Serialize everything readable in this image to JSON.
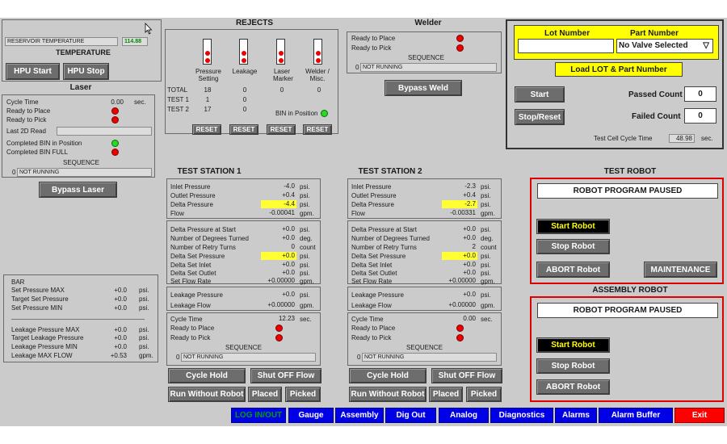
{
  "hpu": {
    "reservoir_label": "RESERVOIR TEMPERATURE",
    "reservoir_value": "114.88",
    "temperature_title": "TEMPERATURE",
    "start": "HPU Start",
    "stop": "HPU Stop"
  },
  "laser": {
    "title": "Laser",
    "cycle_time_label": "Cycle Time",
    "cycle_time_value": "0.00",
    "cycle_time_unit": "sec.",
    "ready_place": "Ready to Place",
    "ready_pick": "Ready to Pick",
    "last_2d_read": "Last 2D Read",
    "completed_in_position": "Completed BIN in Position",
    "completed_full": "Completed BIN FULL",
    "sequence_label": "SEQUENCE",
    "sequence_num": "0",
    "sequence_text": "NOT RUNNING",
    "bypass": "Bypass Laser"
  },
  "rejects": {
    "title": "REJECTS",
    "columns": [
      "Pressure Setting",
      "Leakage",
      "Laser Marker",
      "Welder / Misc."
    ],
    "rows": [
      {
        "label": "TOTAL",
        "values": [
          "18",
          "0",
          "0",
          "0"
        ]
      },
      {
        "label": "TEST 1",
        "values": [
          "1",
          "0"
        ]
      },
      {
        "label": "TEST 2",
        "values": [
          "17",
          "0"
        ]
      }
    ],
    "bin_in_position": "BIN in Position",
    "reset": "RESET"
  },
  "welder": {
    "title": "Welder",
    "ready_place": "Ready to Place",
    "ready_pick": "Ready to Pick",
    "sequence_label": "SEQUENCE",
    "sequence_num": "0",
    "sequence_text": "NOT RUNNING",
    "bypass": "Bypass Weld"
  },
  "lot": {
    "lot_label": "Lot Number",
    "part_label": "Part Number",
    "part_selected": "No Valve Selected",
    "load_button": "Load LOT & Part Number",
    "start": "Start",
    "stop_reset": "Stop/Reset",
    "passed_label": "Passed Count",
    "passed_value": "0",
    "failed_label": "Failed Count",
    "failed_value": "0",
    "cycle_label": "Test Cell Cycle Time",
    "cycle_value": "48.98",
    "cycle_unit": "sec."
  },
  "bar": {
    "title": "BAR",
    "rows": [
      {
        "label": "Set Pressure MAX",
        "value": "+0.0",
        "unit": "psi."
      },
      {
        "label": "Target Set Pressure",
        "value": "+0.0",
        "unit": "psi."
      },
      {
        "label": "Set Pressure MIN",
        "value": "+0.0",
        "unit": "psi."
      },
      {
        "label": "Leakage Pressure MAX",
        "value": "+0.0",
        "unit": "psi."
      },
      {
        "label": "Target Leakage Pressure",
        "value": "+0.0",
        "unit": "psi."
      },
      {
        "label": "Leakage Pressure MIN",
        "value": "+0.0",
        "unit": "psi."
      },
      {
        "label": "Leakage MAX FLOW",
        "value": "+0.53",
        "unit": "gpm."
      }
    ]
  },
  "stations": [
    {
      "title": "TEST STATION 1",
      "p1": [
        {
          "label": "Inlet Pressure",
          "value": "-4.0",
          "unit": "psi."
        },
        {
          "label": "Outlet Pressure",
          "value": "+0.4",
          "unit": "psi."
        },
        {
          "label": "Delta Pressure",
          "value": "-4.4",
          "unit": "psi."
        },
        {
          "label": "Flow",
          "value": "-0.00041",
          "unit": "gpm."
        }
      ],
      "p2": [
        {
          "label": "Delta Pressure at Start",
          "value": "+0.0",
          "unit": "psi."
        },
        {
          "label": "Number of Degrees Turned",
          "value": "+0.0",
          "unit": "deg."
        },
        {
          "label": "Number of Retry Turns",
          "value": "0",
          "unit": "count"
        },
        {
          "label": "Delta Set Pressure",
          "value": "+0.0",
          "unit": "psi."
        },
        {
          "label": "Delta Set Inlet",
          "value": "+0.0",
          "unit": "psi."
        },
        {
          "label": "Delta Set Outlet",
          "value": "+0.0",
          "unit": "psi."
        },
        {
          "label": "Set Flow Rate",
          "value": "+0.00000",
          "unit": "gpm."
        }
      ],
      "p3": [
        {
          "label": "Leakage Pressure",
          "value": "+0.0",
          "unit": "psi."
        },
        {
          "label": "Leakage Flow",
          "value": "+0.00000",
          "unit": "gpm."
        }
      ],
      "cycle_label": "Cycle Time",
      "cycle_value": "12.23",
      "cycle_unit": "sec.",
      "ready_place": "Ready to Place",
      "ready_pick": "Ready to Pick",
      "sequence_label": "SEQUENCE",
      "sequence_num": "0",
      "sequence_text": "NOT RUNNING",
      "cycle_hold": "Cycle Hold",
      "shut_off": "Shut OFF Flow",
      "run_without_robot": "Run Without Robot",
      "placed": "Placed",
      "picked": "Picked"
    },
    {
      "title": "TEST STATION 2",
      "p1": [
        {
          "label": "Inlet Pressure",
          "value": "-2.3",
          "unit": "psi."
        },
        {
          "label": "Outlet Pressure",
          "value": "+0.4",
          "unit": "psi."
        },
        {
          "label": "Delta Pressure",
          "value": "-2.7",
          "unit": "psi."
        },
        {
          "label": "Flow",
          "value": "-0.00331",
          "unit": "gpm."
        }
      ],
      "p2": [
        {
          "label": "Delta Pressure at Start",
          "value": "+0.0",
          "unit": "psi."
        },
        {
          "label": "Number of Degrees Turned",
          "value": "+0.0",
          "unit": "deg."
        },
        {
          "label": "Number of Retry Turns",
          "value": "2",
          "unit": "count"
        },
        {
          "label": "Delta Set Pressure",
          "value": "+0.0",
          "unit": "psi."
        },
        {
          "label": "Delta Set Inlet",
          "value": "+0.0",
          "unit": "psi."
        },
        {
          "label": "Delta Set Outlet",
          "value": "+0.0",
          "unit": "psi."
        },
        {
          "label": "Set Flow Rate",
          "value": "+0.00000",
          "unit": "gpm."
        }
      ],
      "p3": [
        {
          "label": "Leakage Pressure",
          "value": "+0.0",
          "unit": "psi."
        },
        {
          "label": "Leakage Flow",
          "value": "+0.00000",
          "unit": "gpm."
        }
      ],
      "cycle_label": "Cycle Time",
      "cycle_value": "0.00",
      "cycle_unit": "sec.",
      "ready_place": "Ready to Place",
      "ready_pick": "Ready to Pick",
      "sequence_label": "SEQUENCE",
      "sequence_num": "0",
      "sequence_text": "NOT RUNNING",
      "cycle_hold": "Cycle Hold",
      "shut_off": "Shut OFF Flow",
      "run_without_robot": "Run Without Robot",
      "placed": "Placed",
      "picked": "Picked"
    }
  ],
  "test_robot": {
    "title": "TEST ROBOT",
    "status": "ROBOT PROGRAM PAUSED",
    "start": "Start Robot",
    "stop": "Stop Robot",
    "abort": "ABORT Robot",
    "maintenance": "MAINTENANCE"
  },
  "assembly_robot": {
    "title": "ASSEMBLY ROBOT",
    "status": "ROBOT PROGRAM PAUSED",
    "start": "Start Robot",
    "stop": "Stop Robot",
    "abort": "ABORT Robot"
  },
  "nav": [
    "LOG IN/OUT",
    "Gauge",
    "Assembly",
    "Dig Out",
    "Analog",
    "Diagnostics",
    "Alarms",
    "Alarm Buffer",
    "Exit"
  ],
  "colors": {
    "nav_blue": "#0000e6",
    "exit_red": "#ff0000",
    "login_green": "#00a000",
    "highlight_yellow": "#ffff34",
    "robot_border_red": "#e00000"
  }
}
